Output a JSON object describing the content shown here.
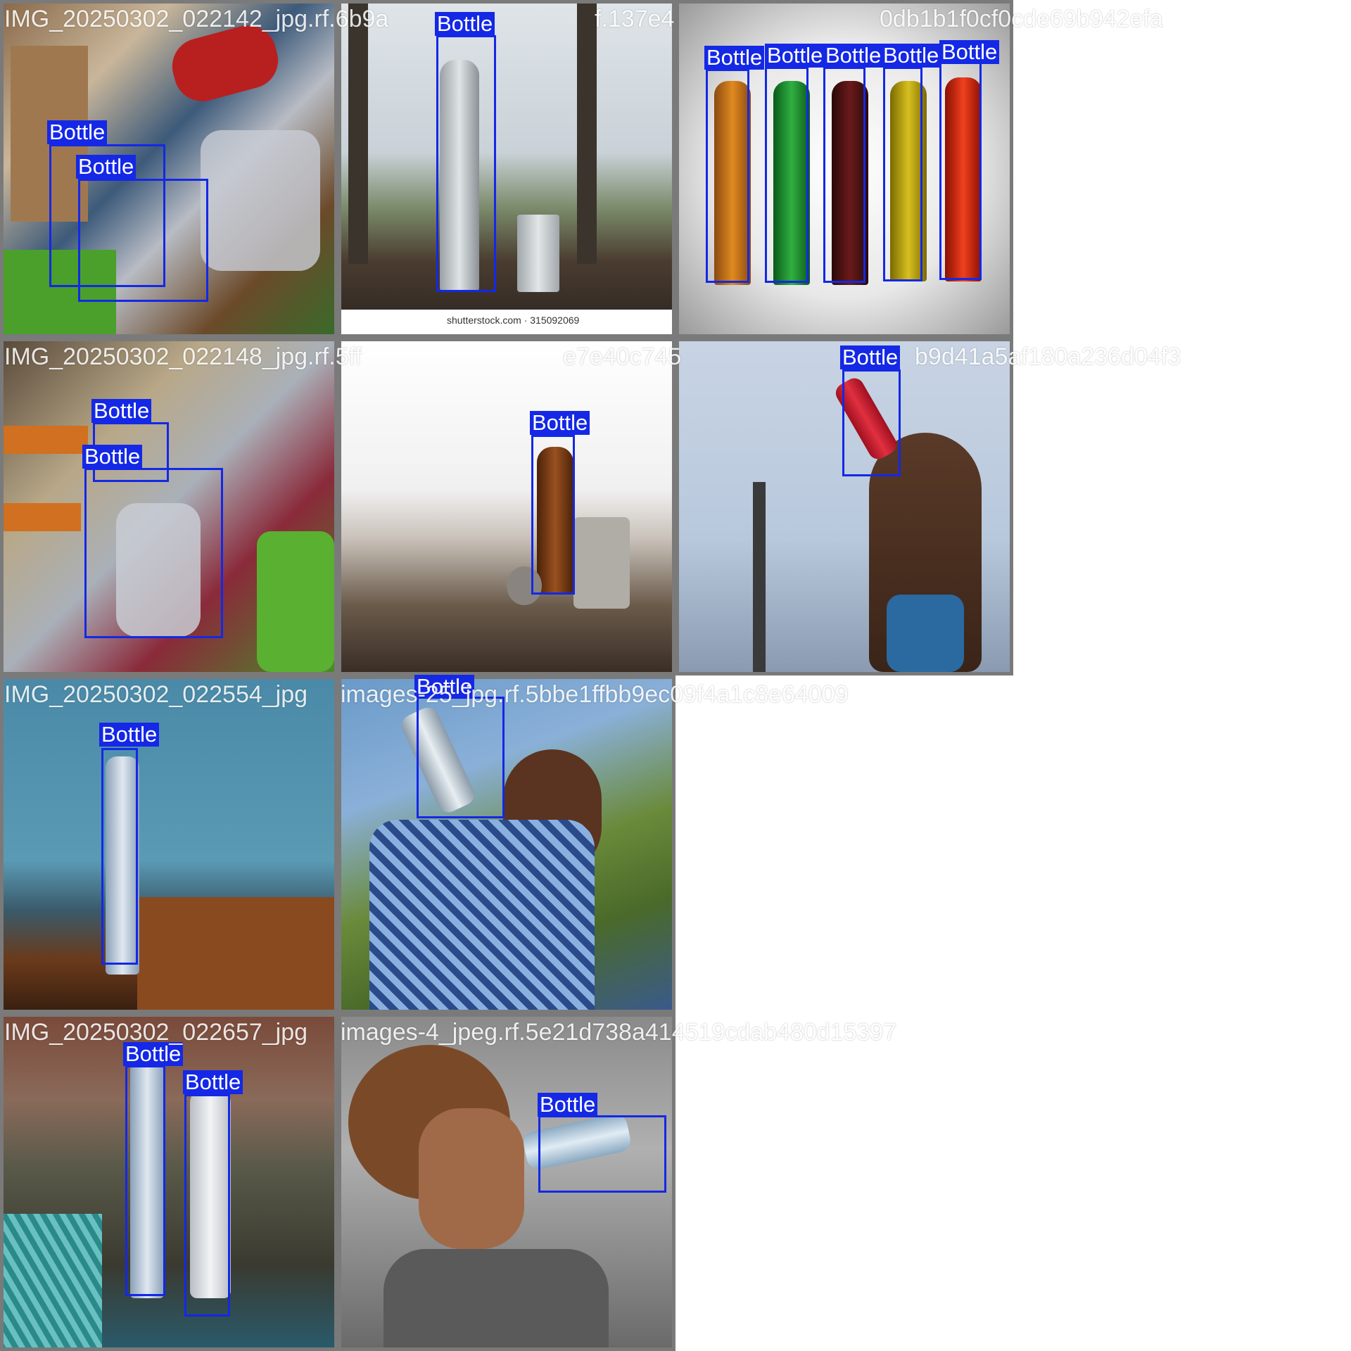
{
  "colors": {
    "box": "#1428e6",
    "label_text": "#ffffff",
    "tile_border": "#7a7a7a"
  },
  "tiles": [
    {
      "filename": "IMG_20250302_022142_jpg.rf.6b9a",
      "labels": [
        "Bottle",
        "Bottle"
      ]
    },
    {
      "filename": "f.137e4",
      "labels": [
        "Bottle"
      ],
      "watermark": "shutterstock.com · 315092069"
    },
    {
      "filename": "0db1b1f0cf0cde69b942efa",
      "labels": [
        "Bottle",
        "Bottle",
        "Bottle",
        "Bottle",
        "Bottle"
      ]
    },
    {
      "filename": "IMG_20250302_022148_jpg.rf.5ff",
      "labels": [
        "Bottle",
        "Bottle"
      ]
    },
    {
      "filename": "e7e40c745",
      "labels": [
        "Bottle"
      ]
    },
    {
      "filename": "b9d41a5af180a236d04f3",
      "labels": [
        "Bottle"
      ]
    },
    {
      "filename": "IMG_20250302_022554_jpg",
      "labels": [
        "Bottle"
      ]
    },
    {
      "filename": "images-25_jpg.rf.5bbe1ffbb9ec09f4a1c8e64009",
      "labels": [
        "Bottle"
      ]
    },
    {
      "filename": "IMG_20250302_022657_jpg",
      "labels": [
        "Bottle",
        "Bottle"
      ]
    },
    {
      "filename": "images-4_jpeg.rf.5e21d738a414519cdab480d15397",
      "labels": [
        "Bottle"
      ]
    }
  ]
}
